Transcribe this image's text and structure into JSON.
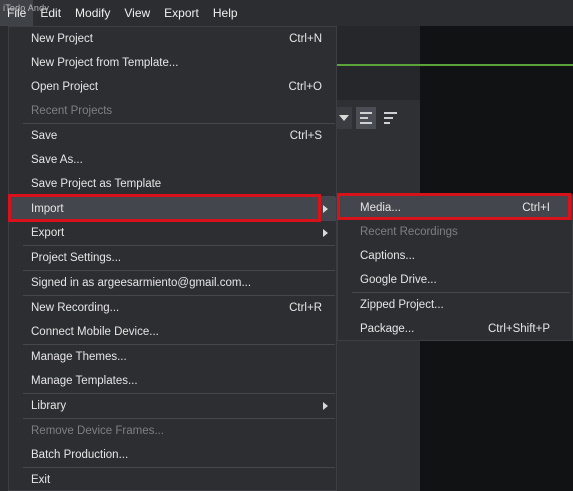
{
  "watermark": "iTodo Andy",
  "menubar": {
    "items": [
      {
        "label": "File"
      },
      {
        "label": "Edit"
      },
      {
        "label": "Modify"
      },
      {
        "label": "View"
      },
      {
        "label": "Export"
      },
      {
        "label": "Help"
      }
    ]
  },
  "file_menu": {
    "new_project": {
      "label": "New Project",
      "shortcut": "Ctrl+N"
    },
    "new_from_template": {
      "label": "New Project from Template..."
    },
    "open_project": {
      "label": "Open Project",
      "shortcut": "Ctrl+O"
    },
    "recent_projects": {
      "label": "Recent Projects"
    },
    "save": {
      "label": "Save",
      "shortcut": "Ctrl+S"
    },
    "save_as": {
      "label": "Save As..."
    },
    "save_as_template": {
      "label": "Save Project as Template"
    },
    "import": {
      "label": "Import"
    },
    "export": {
      "label": "Export"
    },
    "project_settings": {
      "label": "Project Settings..."
    },
    "signed_in": {
      "label": "Signed in as argeesarmiento@gmail.com..."
    },
    "new_recording": {
      "label": "New Recording...",
      "shortcut": "Ctrl+R"
    },
    "connect_mobile": {
      "label": "Connect Mobile Device..."
    },
    "manage_themes": {
      "label": "Manage Themes..."
    },
    "manage_templates": {
      "label": "Manage Templates..."
    },
    "library": {
      "label": "Library"
    },
    "remove_device_frames": {
      "label": "Remove Device Frames..."
    },
    "batch_production": {
      "label": "Batch Production..."
    },
    "exit": {
      "label": "Exit"
    }
  },
  "import_submenu": {
    "media": {
      "label": "Media...",
      "shortcut": "Ctrl+I"
    },
    "recent_recordings": {
      "label": "Recent Recordings"
    },
    "captions": {
      "label": "Captions..."
    },
    "google_drive": {
      "label": "Google Drive..."
    },
    "zipped_project": {
      "label": "Zipped Project..."
    },
    "package": {
      "label": "Package...",
      "shortcut": "Ctrl+Shift+P"
    }
  },
  "colors": {
    "menu_bg": "#2d2e32",
    "highlight": "#43464c",
    "annotation_red": "#d8121b",
    "canvas_accent": "#5aa23a"
  }
}
